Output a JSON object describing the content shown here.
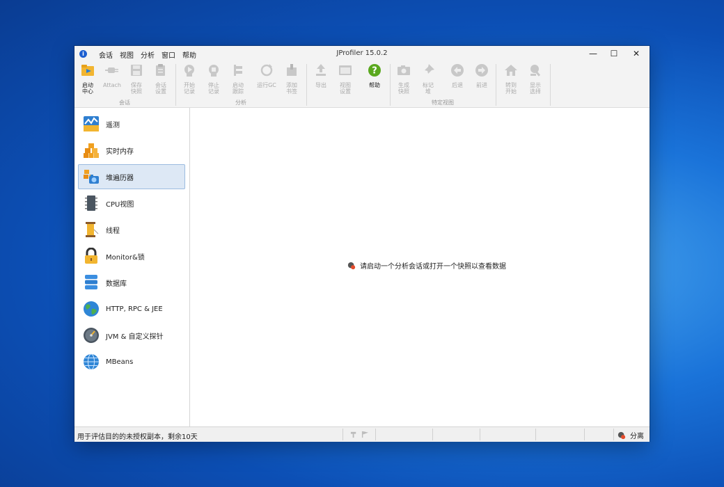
{
  "window": {
    "title": "JProfiler 15.0.2",
    "menu": [
      "会话",
      "视图",
      "分析",
      "窗口",
      "帮助"
    ],
    "controls": {
      "minimize": "—",
      "maximize": "☐",
      "close": "✕"
    }
  },
  "toolbar": {
    "buttons": [
      {
        "label": "启动\n中心",
        "icon": "start-center-icon",
        "enabled": true
      },
      {
        "label": "Attach",
        "icon": "attach-icon",
        "enabled": false
      },
      {
        "label": "保存\n快照",
        "icon": "save-snapshot-icon",
        "enabled": false
      },
      {
        "label": "会话\n设置",
        "icon": "session-settings-icon",
        "enabled": false
      },
      {
        "label": "开始\n记录",
        "icon": "start-recording-icon",
        "enabled": false
      },
      {
        "label": "停止\n记录",
        "icon": "stop-recording-icon",
        "enabled": false
      },
      {
        "label": "启动\n跟踪",
        "icon": "start-tracking-icon",
        "enabled": false
      },
      {
        "label": "运行GC",
        "icon": "run-gc-icon",
        "enabled": false
      },
      {
        "label": "添加\n书签",
        "icon": "add-bookmark-icon",
        "enabled": false
      },
      {
        "label": "导出",
        "icon": "export-icon",
        "enabled": false
      },
      {
        "label": "视图\n设置",
        "icon": "view-settings-icon",
        "enabled": false
      },
      {
        "label": "帮助",
        "icon": "help-icon",
        "enabled": true
      },
      {
        "label": "生成\n快照",
        "icon": "camera-icon",
        "enabled": false
      },
      {
        "label": "标记\n堆",
        "icon": "pin-icon",
        "enabled": false
      },
      {
        "label": "后退",
        "icon": "back-icon",
        "enabled": false
      },
      {
        "label": "前进",
        "icon": "forward-icon",
        "enabled": false
      },
      {
        "label": "转到\n开始",
        "icon": "home-icon",
        "enabled": false
      },
      {
        "label": "显示\n选择",
        "icon": "show-selection-icon",
        "enabled": false
      }
    ],
    "groups": [
      "会话",
      "分析",
      "特定视图"
    ]
  },
  "sidebar": {
    "items": [
      {
        "label": "遥测",
        "icon": "telemetry-icon"
      },
      {
        "label": "实时内存",
        "icon": "live-memory-icon"
      },
      {
        "label": "堆遍历器",
        "icon": "heap-walker-icon",
        "selected": true
      },
      {
        "label": "CPU视图",
        "icon": "cpu-views-icon"
      },
      {
        "label": "线程",
        "icon": "threads-icon"
      },
      {
        "label": "Monitor&锁",
        "icon": "monitor-lock-icon"
      },
      {
        "label": "数据库",
        "icon": "database-icon"
      },
      {
        "label": "HTTP, RPC & JEE",
        "icon": "globe-icon"
      },
      {
        "label": "JVM & 自定义探针",
        "icon": "gauge-icon"
      },
      {
        "label": "MBeans",
        "icon": "mbeans-icon"
      }
    ]
  },
  "main": {
    "message": "请启动一个分析会话或打开一个快照以查看数据"
  },
  "status": {
    "left_text": "用于评估目的的未授权副本，剩余10天",
    "right_text": "分离"
  },
  "colors": {
    "accent": "#1d5fd0",
    "selected_bg": "#dde8f5",
    "help_green": "#5aa81e"
  }
}
